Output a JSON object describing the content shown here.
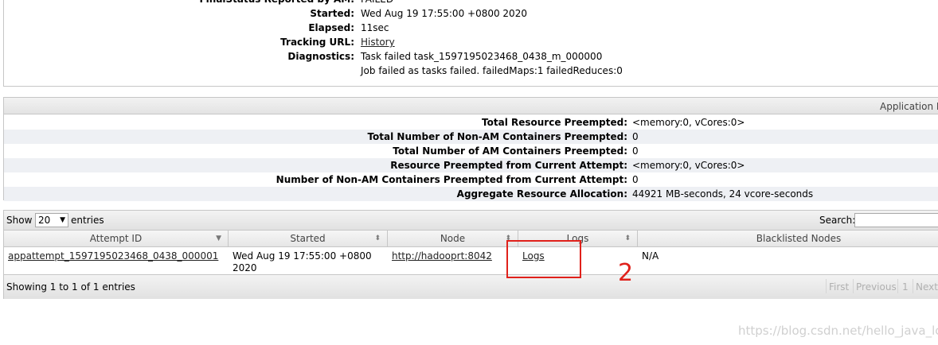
{
  "app_info": {
    "rows": [
      {
        "label": "FinalStatus Reported by AM:",
        "value": "FAILED"
      },
      {
        "label": "Started:",
        "value": "Wed Aug 19 17:55:00 +0800 2020"
      },
      {
        "label": "Elapsed:",
        "value": "11sec"
      },
      {
        "label": "Tracking URL:",
        "value": "History"
      },
      {
        "label": "Diagnostics:",
        "value": "Task failed task_1597195023468_0438_m_000000",
        "value2": "Job failed as tasks failed. failedMaps:1 failedReduces:0"
      }
    ]
  },
  "metrics": {
    "header": "Application M",
    "rows": [
      {
        "label": "Total Resource Preempted:",
        "value": "<memory:0, vCores:0>"
      },
      {
        "label": "Total Number of Non-AM Containers Preempted:",
        "value": "0"
      },
      {
        "label": "Total Number of AM Containers Preempted:",
        "value": "0"
      },
      {
        "label": "Resource Preempted from Current Attempt:",
        "value": "<memory:0, vCores:0>"
      },
      {
        "label": "Number of Non-AM Containers Preempted from Current Attempt:",
        "value": "0"
      },
      {
        "label": "Aggregate Resource Allocation:",
        "value": "44921 MB-seconds, 24 vcore-seconds"
      }
    ]
  },
  "table": {
    "show_label": "Show",
    "entries_value": "20",
    "entries_label": "entries",
    "search_label": "Search:",
    "search_value": "",
    "columns": [
      "Attempt ID",
      "Started",
      "Node",
      "Logs",
      "Blacklisted Nodes"
    ],
    "row": {
      "attempt_id": "appattempt_1597195023468_0438_000001",
      "started_line1": "Wed Aug 19 17:55:00 +0800",
      "started_line2": "2020",
      "node": "http://hadooprt:8042",
      "logs": "Logs",
      "blacklisted": "N/A"
    },
    "showing": "Showing 1 to 1 of 1 entries",
    "pager": {
      "first": "First",
      "previous": "Previous",
      "page": "1",
      "next": "Next"
    }
  },
  "annotation": {
    "number": "2",
    "color": "#e0211b"
  },
  "watermark": "https://blog.csdn.net/hello_java_lcl"
}
